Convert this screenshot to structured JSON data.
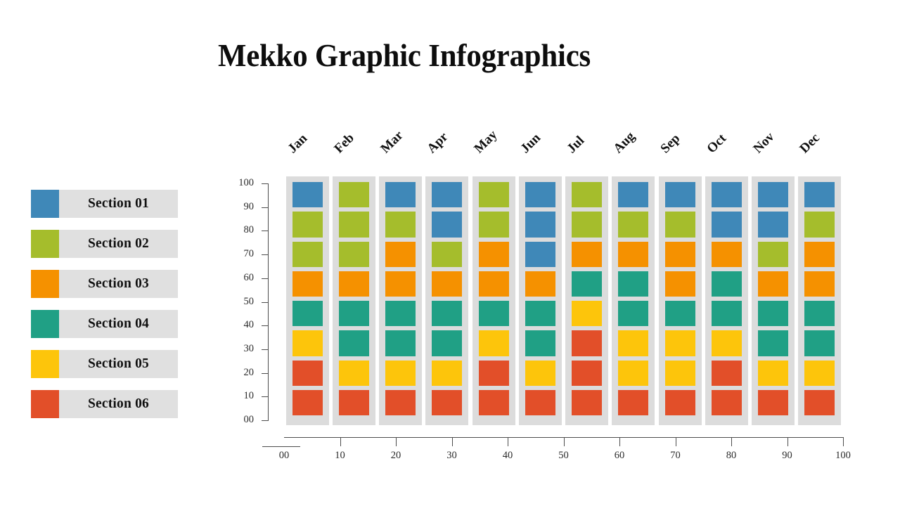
{
  "title": "Mekko Graphic Infographics",
  "colors": {
    "section_01": "#3f88b8",
    "section_02": "#a5bd2c",
    "section_03": "#f59100",
    "section_04": "#20a085",
    "section_05": "#fdc50b",
    "section_06": "#e24f29",
    "track": "#dcdcdc",
    "legend_label_bg": "#e0e0e0",
    "axis": "#4c4c4c",
    "text": "#111111",
    "background": "#ffffff"
  },
  "legend": {
    "items": [
      {
        "label": "Section 01",
        "color_key": "section_01"
      },
      {
        "label": "Section 02",
        "color_key": "section_02"
      },
      {
        "label": "Section 03",
        "color_key": "section_03"
      },
      {
        "label": "Section 04",
        "color_key": "section_04"
      },
      {
        "label": "Section 05",
        "color_key": "section_05"
      },
      {
        "label": "Section 06",
        "color_key": "section_06"
      }
    ]
  },
  "chart_data": {
    "type": "bar",
    "title": "Mekko Graphic Infographics",
    "xlabel": "",
    "ylabel": "",
    "grid": false,
    "legend_position": "left",
    "stacked": true,
    "segments_per_column": 8,
    "segment_value": 12.5,
    "categories": [
      "Jan",
      "Feb",
      "Mar",
      "Apr",
      "May",
      "Jun",
      "Jul",
      "Aug",
      "Sep",
      "Oct",
      "Nov",
      "Dec"
    ],
    "x_axis": {
      "ticks": [
        "00",
        "10",
        "20",
        "30",
        "40",
        "50",
        "60",
        "70",
        "80",
        "90",
        "100"
      ],
      "range": [
        0,
        100
      ]
    },
    "y_axis": {
      "ticks": [
        "00",
        "10",
        "20",
        "30",
        "40",
        "50",
        "60",
        "70",
        "80",
        "90",
        "100"
      ],
      "range": [
        0,
        100
      ]
    },
    "series": [
      {
        "name": "Section 01",
        "color_key": "section_01",
        "values": [
          12.5,
          0,
          12.5,
          25,
          0,
          37.5,
          0,
          12.5,
          12.5,
          25,
          25,
          12.5
        ]
      },
      {
        "name": "Section 02",
        "color_key": "section_02",
        "values": [
          25,
          37.5,
          12.5,
          12.5,
          25,
          0,
          25,
          12.5,
          12.5,
          0,
          12.5,
          12.5
        ]
      },
      {
        "name": "Section 03",
        "color_key": "section_03",
        "values": [
          12.5,
          12.5,
          25,
          12.5,
          25,
          12.5,
          12.5,
          12.5,
          25,
          12.5,
          12.5,
          25
        ]
      },
      {
        "name": "Section 04",
        "color_key": "section_04",
        "values": [
          12.5,
          25,
          25,
          25,
          12.5,
          25,
          12.5,
          25,
          12.5,
          25,
          25,
          25
        ]
      },
      {
        "name": "Section 05",
        "color_key": "section_05",
        "values": [
          12.5,
          12.5,
          12.5,
          12.5,
          12.5,
          12.5,
          12.5,
          25,
          25,
          12.5,
          12.5,
          12.5
        ]
      },
      {
        "name": "Section 06",
        "color_key": "section_06",
        "values": [
          25,
          12.5,
          12.5,
          12.5,
          25,
          12.5,
          37.5,
          12.5,
          12.5,
          25,
          12.5,
          12.5
        ]
      }
    ],
    "columns": [
      {
        "month": "Jan",
        "stack_top_to_bottom": [
          "section_01",
          "section_02",
          "section_02",
          "section_03",
          "section_04",
          "section_05",
          "section_06",
          "section_06"
        ]
      },
      {
        "month": "Feb",
        "stack_top_to_bottom": [
          "section_02",
          "section_02",
          "section_02",
          "section_03",
          "section_04",
          "section_04",
          "section_05",
          "section_06"
        ]
      },
      {
        "month": "Mar",
        "stack_top_to_bottom": [
          "section_01",
          "section_02",
          "section_03",
          "section_03",
          "section_04",
          "section_04",
          "section_05",
          "section_06"
        ]
      },
      {
        "month": "Apr",
        "stack_top_to_bottom": [
          "section_01",
          "section_01",
          "section_02",
          "section_03",
          "section_04",
          "section_04",
          "section_05",
          "section_06"
        ]
      },
      {
        "month": "May",
        "stack_top_to_bottom": [
          "section_02",
          "section_02",
          "section_03",
          "section_03",
          "section_04",
          "section_05",
          "section_06",
          "section_06"
        ]
      },
      {
        "month": "Jun",
        "stack_top_to_bottom": [
          "section_01",
          "section_01",
          "section_01",
          "section_03",
          "section_04",
          "section_04",
          "section_05",
          "section_06"
        ]
      },
      {
        "month": "Jul",
        "stack_top_to_bottom": [
          "section_02",
          "section_02",
          "section_03",
          "section_04",
          "section_05",
          "section_06",
          "section_06",
          "section_06"
        ]
      },
      {
        "month": "Aug",
        "stack_top_to_bottom": [
          "section_01",
          "section_02",
          "section_03",
          "section_04",
          "section_04",
          "section_05",
          "section_05",
          "section_06"
        ]
      },
      {
        "month": "Sep",
        "stack_top_to_bottom": [
          "section_01",
          "section_02",
          "section_03",
          "section_03",
          "section_04",
          "section_05",
          "section_05",
          "section_06"
        ]
      },
      {
        "month": "Oct",
        "stack_top_to_bottom": [
          "section_01",
          "section_01",
          "section_03",
          "section_04",
          "section_04",
          "section_05",
          "section_06",
          "section_06"
        ]
      },
      {
        "month": "Nov",
        "stack_top_to_bottom": [
          "section_01",
          "section_01",
          "section_02",
          "section_03",
          "section_04",
          "section_04",
          "section_05",
          "section_06"
        ]
      },
      {
        "month": "Dec",
        "stack_top_to_bottom": [
          "section_01",
          "section_02",
          "section_03",
          "section_03",
          "section_04",
          "section_04",
          "section_05",
          "section_06"
        ]
      }
    ]
  }
}
